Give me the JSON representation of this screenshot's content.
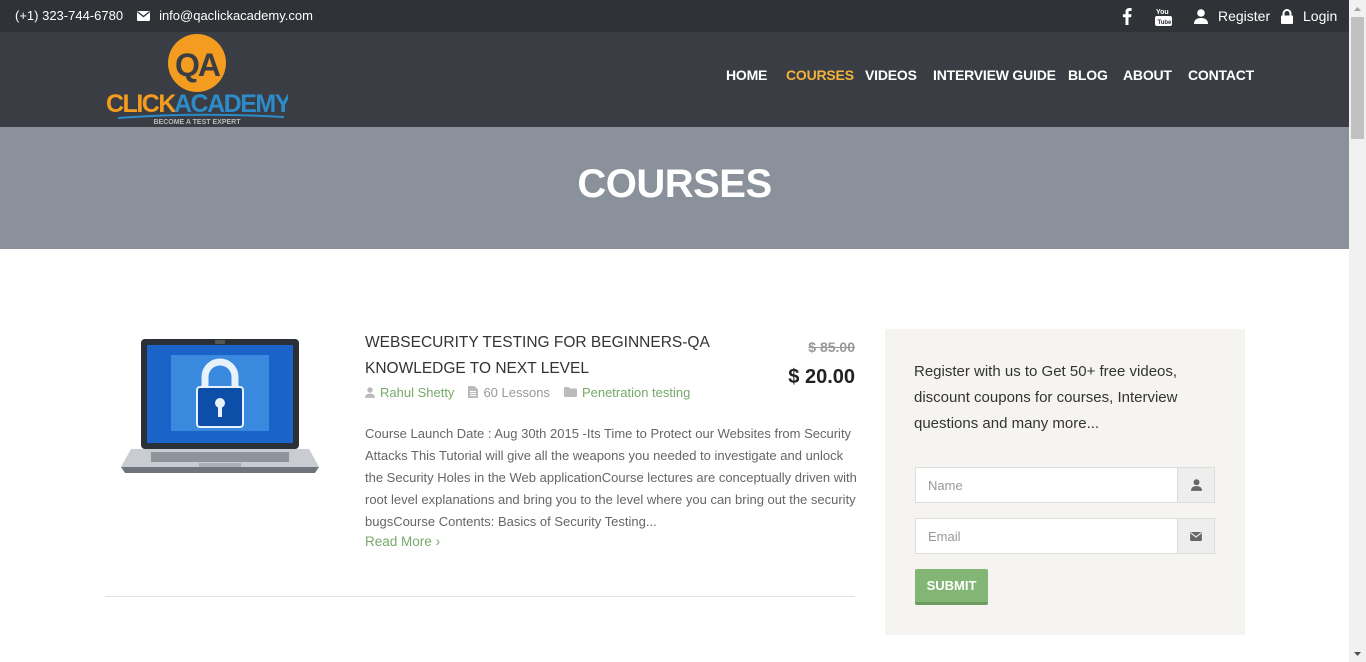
{
  "topbar": {
    "phone": "(+1) 323-744-6780",
    "email": "info@qaclickacademy.com",
    "register": "Register",
    "login": "Login",
    "icons": [
      "facebook-icon",
      "youtube-icon",
      "user-icon",
      "lock-icon"
    ]
  },
  "logo": {
    "mark": "QA",
    "name_part1": "CLICK",
    "name_part2": "ACADEMY",
    "tagline": "BECOME A TEST EXPERT"
  },
  "nav": {
    "items": [
      "HOME",
      "COURSES",
      "VIDEOS",
      "INTERVIEW GUIDE",
      "BLOG",
      "ABOUT",
      "CONTACT"
    ],
    "active": "COURSES"
  },
  "banner": {
    "title": "COURSES"
  },
  "course": {
    "title": "WEBSECURITY TESTING FOR BEGINNERS-QA KNOWLEDGE TO NEXT LEVEL",
    "price_old": "$ 85.00",
    "price_new": "$ 20.00",
    "author": "Rahul Shetty",
    "lessons": "60 Lessons",
    "category": "Penetration testing",
    "description": "Course Launch Date : Aug 30th 2015 -Its Time to Protect our Websites from Security Attacks This Tutorial will give all the weapons you needed to investigate and unlock the Security Holes in the Web applicationCourse lectures are conceptually driven with root level explanations and bring you to the level where you can bring out the security bugsCourse Contents: Basics of Security Testing...",
    "read_more": "Read More"
  },
  "sidebar": {
    "text": "Register with us to Get 50+ free videos, discount coupons for courses, Interview questions and many more...",
    "name_placeholder": "Name",
    "email_placeholder": "Email",
    "submit": "SUBMIT"
  },
  "colors": {
    "topbar": "#2f3237",
    "header": "#3a3d43",
    "banner": "#8a919a",
    "accent_nav": "#f3b33b",
    "green": "#78a96b",
    "submit": "#83b575"
  }
}
